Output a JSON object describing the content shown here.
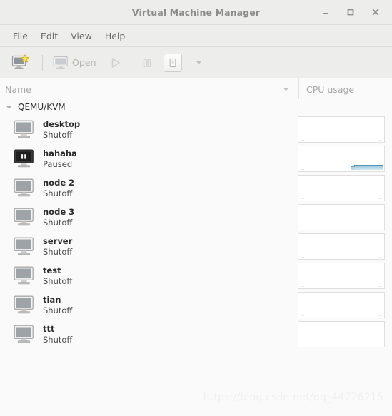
{
  "window": {
    "title": "Virtual Machine Manager",
    "buttons": {
      "minimize": "minimize-icon",
      "maximize": "maximize-icon",
      "close": "close-icon"
    }
  },
  "menubar": {
    "items": [
      {
        "label": "File"
      },
      {
        "label": "Edit"
      },
      {
        "label": "View"
      },
      {
        "label": "Help"
      }
    ]
  },
  "toolbar": {
    "new_vm_icon": "new-vm-monitor-star-icon",
    "open_label": "Open",
    "open_icon": "monitor-icon",
    "run_icon": "play-triangle-icon",
    "pause_icon": "pause-bars-icon",
    "shutdown_icon": "power-switch-icon",
    "dropdown_icon": "chevron-down-icon"
  },
  "columns": {
    "name": "Name",
    "cpu": "CPU usage",
    "sort_icon": "sort-descending-arrow-icon"
  },
  "connection": {
    "label": "QEMU/KVM",
    "expander_icon": "triangle-down-icon",
    "expanded": true
  },
  "vms": [
    {
      "name": "desktop",
      "state": "Shutoff",
      "icon": "monitor-icon",
      "has_activity": false
    },
    {
      "name": "hahaha",
      "state": "Paused",
      "icon": "monitor-paused-icon",
      "has_activity": true
    },
    {
      "name": "node 2",
      "state": "Shutoff",
      "icon": "monitor-icon",
      "has_activity": false
    },
    {
      "name": "node 3",
      "state": "Shutoff",
      "icon": "monitor-icon",
      "has_activity": false
    },
    {
      "name": "server",
      "state": "Shutoff",
      "icon": "monitor-icon",
      "has_activity": false
    },
    {
      "name": "test",
      "state": "Shutoff",
      "icon": "monitor-icon",
      "has_activity": false
    },
    {
      "name": "tian",
      "state": "Shutoff",
      "icon": "monitor-icon",
      "has_activity": false
    },
    {
      "name": "ttt",
      "state": "Shutoff",
      "icon": "monitor-icon",
      "has_activity": false
    }
  ],
  "watermark": "https://blog.csdn.net/qq_44776215",
  "colors": {
    "chrome": "#ededeb",
    "content": "#fafafa",
    "title_text": "#8c8c8c",
    "graph_line": "#5d9dbd",
    "star": "#f3e04a"
  }
}
